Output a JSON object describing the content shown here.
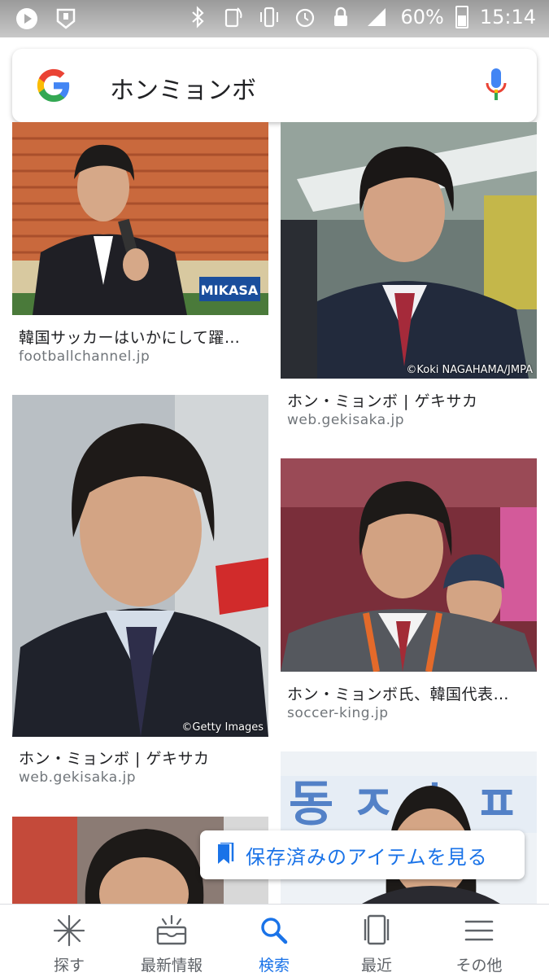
{
  "status_bar": {
    "battery": "60%",
    "time": "15:14",
    "icons": [
      "play-icon",
      "notification-icon",
      "bluetooth-icon",
      "nfc-icon",
      "vibrate-icon",
      "alarm-icon",
      "lock-icon",
      "signal-icon",
      "battery-icon"
    ]
  },
  "search": {
    "query": "ホンミョンボ",
    "logo": "google-logo",
    "mic": "mic-icon"
  },
  "results": [
    {
      "title": "韓国サッカーはいかにして躍…",
      "source": "footballchannel.jp",
      "overlay": "MIKASA"
    },
    {
      "title": "ホン・ミョンボ | ゲキサカ",
      "source": "web.gekisaka.jp",
      "credit": "©Koki NAGAHAMA/JMPA"
    },
    {
      "title": "ホン・ミョンボ | ゲキサカ",
      "source": "web.gekisaka.jp",
      "credit": "©Getty Images"
    },
    {
      "title": "ホン・ミョンボ氏、韓国代表…",
      "source": "soccer-king.jp"
    },
    {
      "title": "",
      "source": ""
    },
    {
      "title": "",
      "source": ""
    }
  ],
  "saved_pill": {
    "label": "保存済みのアイテムを見る",
    "icon": "bookmark-icon"
  },
  "bottom_nav": [
    {
      "label": "探す",
      "icon": "sparkle-icon"
    },
    {
      "label": "最新情報",
      "icon": "updates-icon"
    },
    {
      "label": "検索",
      "icon": "search-icon"
    },
    {
      "label": "最近",
      "icon": "recent-icon"
    },
    {
      "label": "その他",
      "icon": "menu-icon"
    }
  ],
  "colors": {
    "accent": "#1a73e8",
    "nav_inactive": "#5f6368"
  }
}
